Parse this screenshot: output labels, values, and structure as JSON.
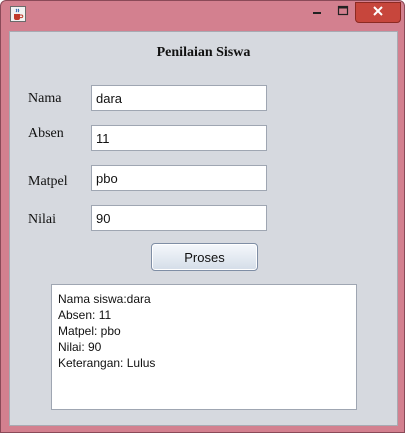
{
  "window": {
    "app_icon": "java-cup-icon",
    "controls": {
      "minimize": "minimize-icon",
      "maximize": "maximize-icon",
      "close": "close-icon"
    },
    "colors": {
      "frame": "#d3808f",
      "close": "#c7463c",
      "content": "#d6d9df"
    }
  },
  "form": {
    "title": "Penilaian Siswa",
    "fields": {
      "nama": {
        "label": "Nama",
        "value": "dara"
      },
      "absen": {
        "label": "Absen",
        "value": "11"
      },
      "matpel": {
        "label": "Matpel",
        "value": "pbo"
      },
      "nilai": {
        "label": "Nilai",
        "value": "90"
      }
    },
    "button": "Proses",
    "output": [
      "Nama siswa:dara",
      "Absen: 11",
      "Matpel: pbo",
      "Nilai: 90",
      "Keterangan: Lulus"
    ]
  }
}
